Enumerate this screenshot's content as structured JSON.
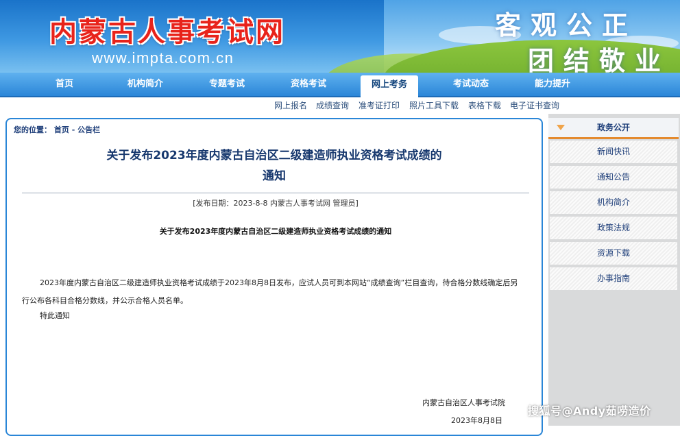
{
  "header": {
    "site_title": "内蒙古人事考试网",
    "url": "www.impta.com.cn",
    "slogan_line1": "客观公正",
    "slogan_line2": "团结敬业"
  },
  "nav": {
    "items": [
      "首页",
      "机构简介",
      "专题考试",
      "资格考试",
      "网上考务",
      "考试动态",
      "能力提升"
    ],
    "active": "网上考务"
  },
  "subnav": {
    "items": [
      "网上报名",
      "成绩查询",
      "准考证打印",
      "照片工具下载",
      "表格下载",
      "电子证书查询"
    ]
  },
  "breadcrumb": {
    "prefix": "您的位置：",
    "home": "首页",
    "separator": " - ",
    "section": "公告栏"
  },
  "article": {
    "title_line1": "关于发布2023年度内蒙古自治区二级建造师执业资格考试成绩的",
    "title_line2": "通知",
    "meta": "[发布日期：2023-8-8 内蒙古人事考试网 管理员]",
    "subtitle": "关于发布2023年度内蒙古自治区二级建造师执业资格考试成绩的通知",
    "body": "2023年度内蒙古自治区二级建造师执业资格考试成绩于2023年8月8日发布，应试人员可到本网站“成绩查询”栏目查询，待合格分数线确定后另行公布各科目合格分数线，并公示合格人员名单。",
    "closing": "特此通知",
    "signature_org": "内蒙古自治区人事考试院",
    "signature_date": "2023年8月8日"
  },
  "sidebar": {
    "header": "政务公开",
    "items": [
      "新闻快讯",
      "通知公告",
      "机构简介",
      "政策法规",
      "资源下载",
      "办事指南"
    ]
  },
  "watermark": "搜狐号@Andy茹唠造价",
  "colors": {
    "nav_blue": "#2b86d8",
    "title_red": "#e8231b",
    "link_navy": "#1f3f7a",
    "sidebar_accent": "#e48a2e"
  }
}
